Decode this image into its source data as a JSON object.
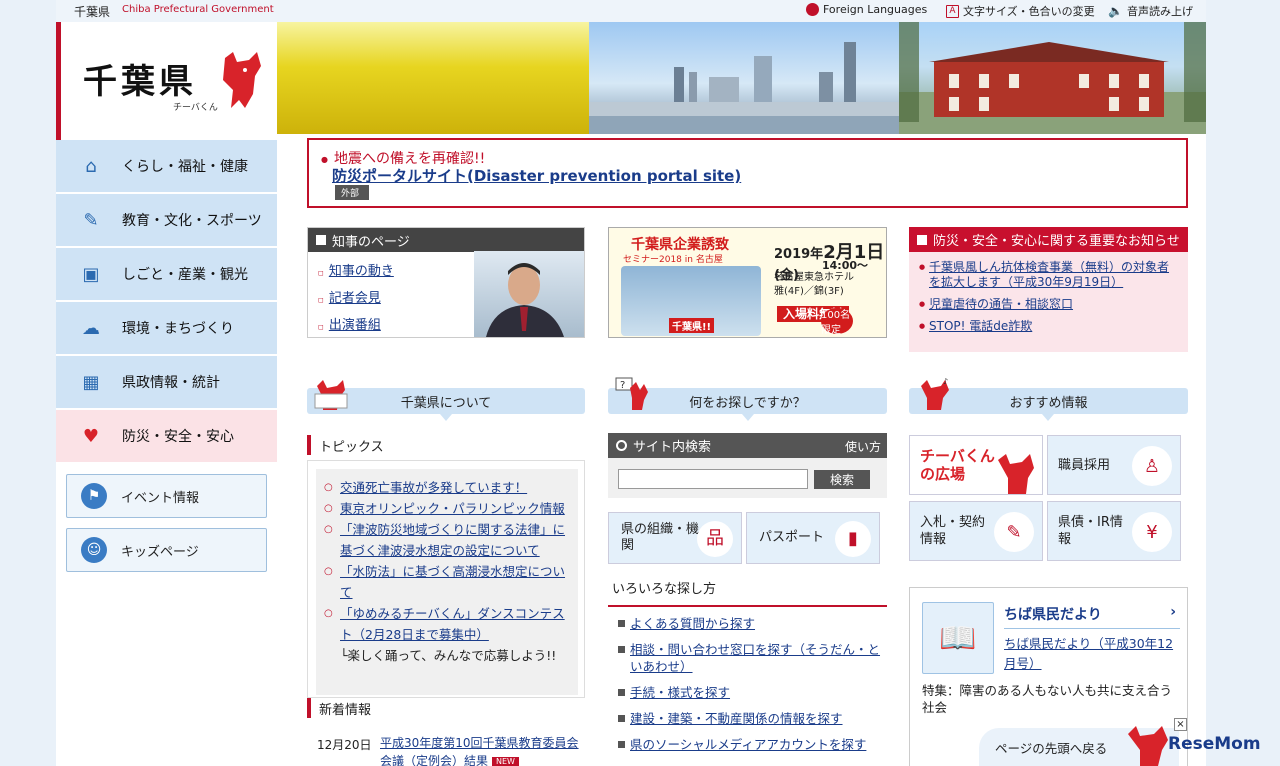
{
  "header": {
    "site_name": "千葉県",
    "site_name_en": "Chiba Prefectural Government",
    "links": [
      {
        "label": "Foreign Languages",
        "icon": "globe-icon"
      },
      {
        "label": "文字サイズ・色合いの変更",
        "icon": "font-size-icon"
      },
      {
        "label": "音声読み上げ",
        "icon": "speaker-icon"
      }
    ]
  },
  "logo": {
    "title": "千葉県",
    "subtitle": "チーバくん"
  },
  "sidebar": {
    "items": [
      {
        "label": "くらし・福祉・健康",
        "icon": "house-icon"
      },
      {
        "label": "教育・文化・スポーツ",
        "icon": "pen-icon"
      },
      {
        "label": "しごと・産業・観光",
        "icon": "briefcase-icon"
      },
      {
        "label": "環境・まちづくり",
        "icon": "weather-icon"
      },
      {
        "label": "県政情報・統計",
        "icon": "building-icon"
      },
      {
        "label": "防災・安全・安心",
        "icon": "heart-icon"
      }
    ],
    "buttons": [
      {
        "label": "イベント情報",
        "icon": "flag-icon"
      },
      {
        "label": "キッズページ",
        "icon": "kid-face-icon"
      }
    ]
  },
  "alert": {
    "title": "地震への備えを再確認!!",
    "link": "防災ポータルサイト(Disaster prevention portal site)",
    "badge": "外部"
  },
  "governor": {
    "heading": "知事のページ",
    "links": [
      "知事の動き",
      "記者会見",
      "出演番組"
    ]
  },
  "ad": {
    "title": "千葉県企業誘致",
    "subtitle": "セミナー2018 in 名古屋",
    "date_prefix": "2019年",
    "date": "2月1日",
    "weekday": "金",
    "time": "14:00～",
    "venue": "名古屋東急ホテル",
    "rooms": "雅(4F)／錦(3F)",
    "free": "入場料無料",
    "limit": "100名限定",
    "slogan": "千葉県!!"
  },
  "notice": {
    "heading": "防災・安全・安心に関する重要なお知らせ",
    "items": [
      "千葉県風しん抗体検査事業（無料）の対象者を拡大します（平成30年9月19日）",
      "児童虐待の通告・相談窓口",
      "STOP! 電話de詐欺"
    ]
  },
  "sections": {
    "about": "千葉県について",
    "search_help": "何をお探しですか？",
    "recommended": "おすすめ情報"
  },
  "topics": {
    "heading": "トピックス",
    "items": [
      "交通死亡事故が多発しています！",
      "東京オリンピック・パラリンピック情報",
      "「津波防災地域づくりに関する法律」に基づく津波浸水想定の設定について",
      "「水防法」に基づく高潮浸水想定について",
      "「ゆめみるチーバくん」ダンスコンテスト（2月28日まで募集中）"
    ],
    "note": "└楽しく踊って、みんなで応募しよう!!"
  },
  "news": {
    "heading": "新着情報",
    "items": [
      {
        "date": "12月20日",
        "title": "平成30年度第10回千葉県教育委員会会議（定例会）結果",
        "badge": "NEW"
      }
    ]
  },
  "search": {
    "heading": "サイト内検索",
    "how": "使い方",
    "value": "",
    "button": "検索"
  },
  "tiles": [
    {
      "label": "県の組織・機関",
      "icon": "org-chart-icon"
    },
    {
      "label": "パスポート",
      "icon": "passport-icon"
    }
  ],
  "ways": {
    "heading": "いろいろな探し方",
    "items": [
      "よくある質問から探す",
      "相談・問い合わせ窓口を探す（そうだん・といあわせ）",
      "手続・様式を探す",
      "建設・建築・不動産関係の情報を探す",
      "県のソーシャルメディアアカウントを探す"
    ]
  },
  "recommend": {
    "tiles": [
      {
        "label": "チーバくんの広場",
        "icon": "chiba-kun-icon"
      },
      {
        "label": "職員採用",
        "icon": "person-tie-icon"
      },
      {
        "label": "入札・契約情報",
        "icon": "document-pen-icon"
      },
      {
        "label": "県債・IR情報",
        "icon": "chart-yen-icon"
      }
    ]
  },
  "kouhou": {
    "title": "ちば県民だより",
    "link": "ちば県民だより（平成30年12月号）",
    "feature": "特集：障害のある人もない人も共に支え合う社会"
  },
  "backtop": "ページの先頭へ戻る",
  "watermark": "ReseMom"
}
